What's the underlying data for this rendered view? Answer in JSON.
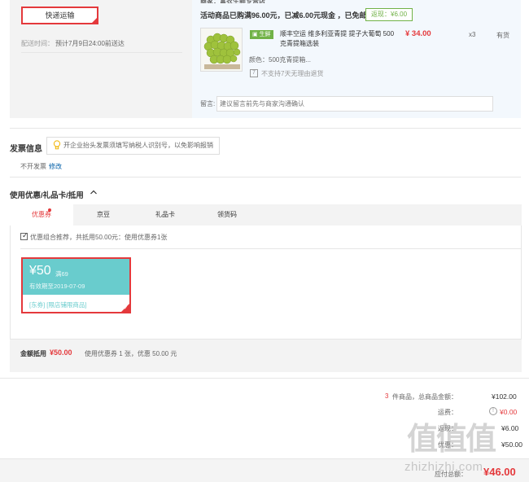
{
  "shipping": {
    "method_button": "快递运输",
    "delivery_label": "配送时间：",
    "delivery_value": "预计7月9日24:00前送达"
  },
  "seller": {
    "header": "商家：富农生鲜专营店",
    "promo_text": "活动商品已购满96.00元，已减6.00元现金 ，已免邮",
    "promo_badge": "返现：¥6.00"
  },
  "product": {
    "tag": "生鲜",
    "title": "顺丰空运 维多利亚青提 提子大葡萄 500克青提箱选装",
    "price": "¥ 34.00",
    "qty": "x3",
    "stock": "有货",
    "color": "颜色：500克青提箱...",
    "no_return": "不支持7天无理由退货"
  },
  "message": {
    "label": "留言:",
    "placeholder": "建议留言前先与商家沟通确认"
  },
  "invoice": {
    "title": "发票信息",
    "tip": "开企业抬头发票须填写纳税人识别号，以免影响报销",
    "value": "不开发票",
    "edit": "修改"
  },
  "coupons": {
    "title": "使用优惠/礼品卡/抵用",
    "tabs": [
      {
        "label": "优惠券"
      },
      {
        "label": "京豆"
      },
      {
        "label": "礼品卡"
      },
      {
        "label": "领货码"
      }
    ],
    "combo_text": "优惠组合推荐，共抵用50.00元：使用优惠券1张",
    "card": {
      "amount": "¥50",
      "min": "满69",
      "expire": "有效期至2019-07-09",
      "tags": "[东券]  [限店铺限商品]"
    },
    "summary_label": "金额抵用",
    "summary_value": "¥50.00",
    "summary_desc": "使用优惠券 1 张，优惠 50.00 元"
  },
  "totals": {
    "count": "3",
    "count_label": "件商品，总商品金额：",
    "goods_total": "¥102.00",
    "shipping_label": "运费：",
    "shipping_value": "¥0.00",
    "row3_label": "返现：",
    "row3_value": "¥6.00",
    "row4_label": "优惠：",
    "row4_value": "¥50.00",
    "pay_label": "应付总额：",
    "pay_value": "¥46.00"
  },
  "watermark": {
    "glyphs": "值值值",
    "url": "zhizhizhi.com"
  },
  "colors": {
    "accent_red": "#e4393c",
    "coupon_teal": "#69cccd",
    "fresh_green": "#71b247",
    "link_blue": "#005ea7"
  }
}
